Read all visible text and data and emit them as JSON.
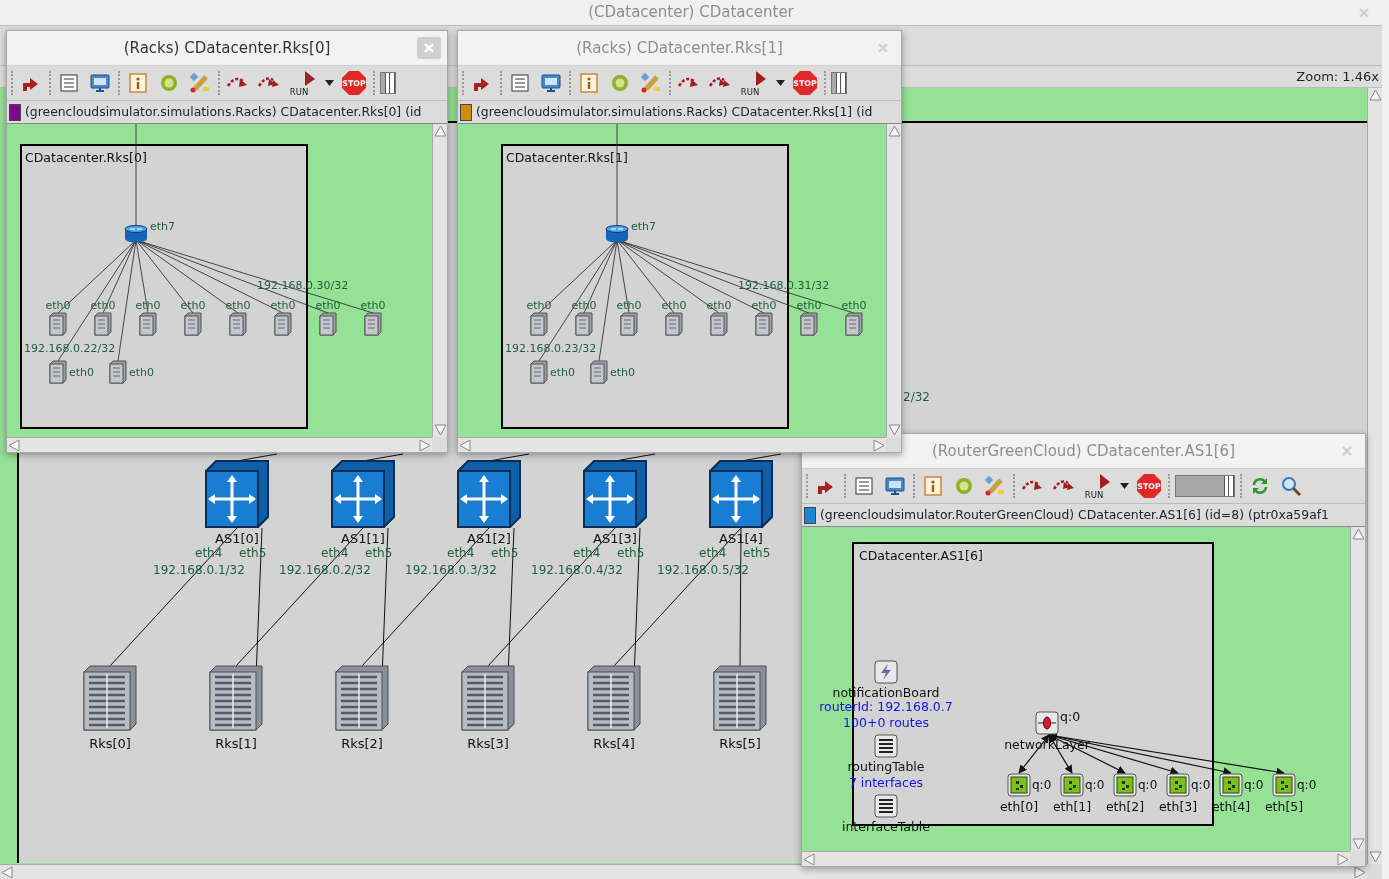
{
  "main_window": {
    "title": "(CDatacenter) CDatacenter",
    "active": false,
    "zoom": "Zoom: 1.46x",
    "switches": [
      {
        "label": "AS1[0]",
        "ports": [
          "eth4",
          "eth5"
        ],
        "ip": "192.168.0.1/32"
      },
      {
        "label": "AS1[1]",
        "ports": [
          "eth4",
          "eth5"
        ],
        "ip": "192.168.0.2/32"
      },
      {
        "label": "AS1[2]",
        "ports": [
          "eth4",
          "eth5"
        ],
        "ip": "192.168.0.3/32"
      },
      {
        "label": "AS1[3]",
        "ports": [
          "eth4",
          "eth5"
        ],
        "ip": "192.168.0.4/32"
      },
      {
        "label": "AS1[4]",
        "ports": [
          "eth4",
          "eth5"
        ],
        "ip": "192.168.0.5/32"
      }
    ],
    "racks": [
      "Rks[0]",
      "Rks[1]",
      "Rks[2]",
      "Rks[3]",
      "Rks[4]",
      "Rks[5]"
    ],
    "labels": [
      "2/32"
    ]
  },
  "windows": [
    {
      "kind": "racks",
      "title": "(Racks) CDatacenter.Rks[0]",
      "active": true,
      "toolbar": [
        {
          "kind": "grip"
        },
        {
          "kind": "up"
        },
        {
          "kind": "grip"
        },
        {
          "kind": "list"
        },
        {
          "kind": "monitor"
        },
        {
          "kind": "grip"
        },
        {
          "kind": "info"
        },
        {
          "kind": "net"
        },
        {
          "kind": "wand"
        },
        {
          "kind": "grip"
        },
        {
          "kind": "step"
        },
        {
          "kind": "fast"
        },
        {
          "kind": "run",
          "caption": "RUN"
        },
        {
          "kind": "caret"
        },
        {
          "kind": "stop",
          "caption": "STOP"
        },
        {
          "kind": "grip"
        },
        {
          "kind": "slider-edge",
          "level": 1
        }
      ],
      "info": {
        "color": "#7b0a8c",
        "text": "(greencloudsimulator.simulations.Racks) CDatacenter.Rks[0]  (id"
      },
      "module": "CDatacenter.Rks[0]",
      "servers": [
        "eth0",
        "eth0",
        "eth0",
        "eth0",
        "eth0",
        "eth0",
        "eth0",
        "eth0",
        "eth0",
        "eth0"
      ],
      "labels": [
        {
          "kind": "router-port",
          "text": "eth7"
        },
        {
          "kind": "uplink-ip",
          "text": "192.168.0.30/32"
        },
        {
          "kind": "server-ip",
          "text": "192.168.0.22/32"
        }
      ]
    },
    {
      "kind": "racks",
      "title": "(Racks) CDatacenter.Rks[1]",
      "active": false,
      "toolbar": [
        {
          "kind": "grip"
        },
        {
          "kind": "up"
        },
        {
          "kind": "grip"
        },
        {
          "kind": "list"
        },
        {
          "kind": "monitor"
        },
        {
          "kind": "grip"
        },
        {
          "kind": "info"
        },
        {
          "kind": "net"
        },
        {
          "kind": "wand"
        },
        {
          "kind": "grip"
        },
        {
          "kind": "step"
        },
        {
          "kind": "fast"
        },
        {
          "kind": "run",
          "caption": "RUN"
        },
        {
          "kind": "caret"
        },
        {
          "kind": "stop",
          "caption": "STOP"
        },
        {
          "kind": "grip"
        },
        {
          "kind": "slider-edge",
          "level": 1
        }
      ],
      "info": {
        "color": "#d08c0a",
        "text": "(greencloudsimulator.simulations.Racks) CDatacenter.Rks[1]  (id"
      },
      "module": "CDatacenter.Rks[1]",
      "servers": [
        "eth0",
        "eth0",
        "eth0",
        "eth0",
        "eth0",
        "eth0",
        "eth0",
        "eth0",
        "eth0",
        "eth0"
      ],
      "labels": [
        {
          "kind": "router-port",
          "text": "eth7"
        },
        {
          "kind": "uplink-ip",
          "text": "192.168.0.31/32"
        },
        {
          "kind": "server-ip",
          "text": "192.168.0.23/32"
        }
      ]
    },
    {
      "kind": "router",
      "title": "(RouterGreenCloud) CDatacenter.AS1[6]",
      "active": false,
      "toolbar": [
        {
          "kind": "grip"
        },
        {
          "kind": "up"
        },
        {
          "kind": "grip"
        },
        {
          "kind": "list"
        },
        {
          "kind": "monitor"
        },
        {
          "kind": "grip"
        },
        {
          "kind": "info"
        },
        {
          "kind": "net"
        },
        {
          "kind": "wand"
        },
        {
          "kind": "grip"
        },
        {
          "kind": "step"
        },
        {
          "kind": "fast"
        },
        {
          "kind": "run",
          "caption": "RUN"
        },
        {
          "kind": "caret"
        },
        {
          "kind": "stop",
          "caption": "STOP"
        },
        {
          "kind": "grip"
        },
        {
          "kind": "slider",
          "level": 1
        },
        {
          "kind": "grip"
        },
        {
          "kind": "refresh"
        },
        {
          "kind": "zoom"
        }
      ],
      "info": {
        "color": "#1a86d6",
        "text": "(greencloudsimulator.RouterGreenCloud) CDatacenter.AS1[6]  (id=8)  (ptr0xa59af1"
      },
      "module": "CDatacenter.AS1[6]",
      "submodules": [
        {
          "kind": "notification",
          "label": "notificationBoard"
        },
        {
          "kind": "table",
          "label": "routingTable",
          "status": "100+0 routes"
        },
        {
          "kind": "table",
          "label": "interfaceTable",
          "status": "7 interfaces"
        }
      ],
      "router_id": "routerId: 192.168.0.7",
      "network_layer": {
        "label": "networkLayer",
        "queue": "q:0"
      },
      "interfaces": [
        {
          "label": "eth[0]",
          "queue": "q:0"
        },
        {
          "label": "eth[1]",
          "queue": "q:0"
        },
        {
          "label": "eth[2]",
          "queue": "q:0"
        },
        {
          "label": "eth[3]",
          "queue": "q:0"
        },
        {
          "label": "eth[4]",
          "queue": "q:0"
        },
        {
          "label": "eth[5]",
          "queue": "q:0"
        }
      ]
    }
  ]
}
